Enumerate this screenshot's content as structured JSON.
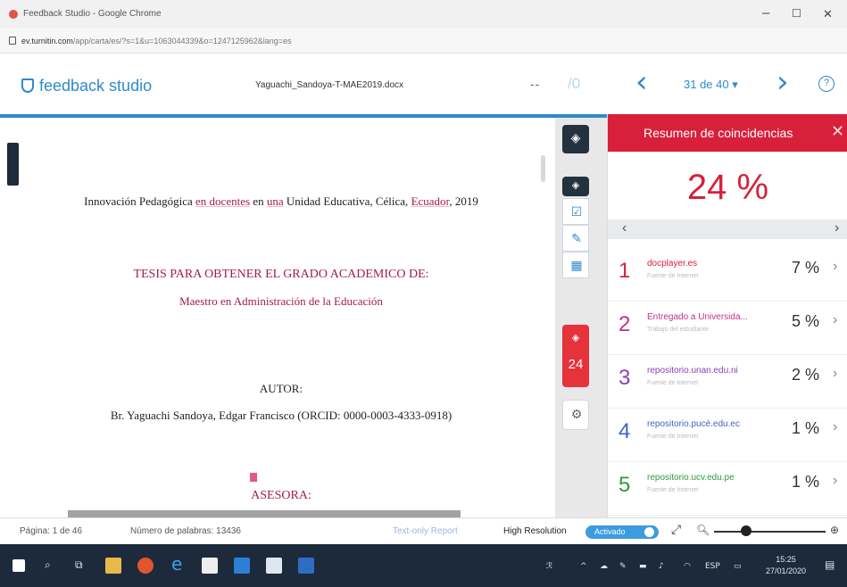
{
  "browser": {
    "window_title": "Feedback Studio - Google Chrome",
    "url_host": "ev.turnitin.com",
    "url_path": "/app/carta/es/?s=1&u=1063044339&o=1247125962&lang=es",
    "controls": {
      "minimize": "–",
      "maximize": "☐",
      "close": "✕"
    }
  },
  "header": {
    "brand": "feedback studio",
    "filename": "Yaguachi_Sandoya-T-MAE2019.docx",
    "dash": "--",
    "slash_zero": "/0",
    "pager": "31 de 40 ▾",
    "prev_icon": "‹",
    "next_icon": "›",
    "help_icon": "?"
  },
  "document": {
    "title_pre": "Innovación Pedagógica ",
    "title_hl1": "en docentes",
    "title_mid": " en ",
    "title_hl2": "una",
    "title_mid2": " Unidad Educativa, Célica, ",
    "title_hl3": "Ecuador",
    "title_post": ", 2019",
    "tesis": "TESIS PARA OBTENER EL GRADO ACADEMICO DE:",
    "degree": "Maestro en Administración de la Educación",
    "autor_label": "AUTOR:",
    "autor": "Br. Yaguachi Sandoya, Edgar Francisco (ORCID: 0000-0003-4333-0918)",
    "asesora_label": "ASESORA:"
  },
  "rail": {
    "count": "24",
    "icons": [
      "layers-icon",
      "layers-small-icon",
      "check-icon",
      "edit-icon",
      "grid-icon",
      "similarity-icon",
      "gear-icon"
    ]
  },
  "panel": {
    "title": "Resumen de coincidencias",
    "close": "✕",
    "total": "24 %",
    "nav_left": "‹",
    "nav_right": "›",
    "matches": [
      {
        "n": "1",
        "source": "docplayer.es",
        "sub": "Fuente de Internet",
        "pct": "7 %",
        "color": "#d8203a"
      },
      {
        "n": "2",
        "source": "Entregado a Universida...",
        "sub": "Trabajo del estudiante",
        "pct": "5 %",
        "color": "#c0328a"
      },
      {
        "n": "3",
        "source": "repositorio.unan.edu.ni",
        "sub": "Fuente de Internet",
        "pct": "2 %",
        "color": "#8e3dba"
      },
      {
        "n": "4",
        "source": "repositorio.pucé.edu.ec",
        "sub": "Fuente de Internet",
        "pct": "1 %",
        "color": "#3f64c8"
      },
      {
        "n": "5",
        "source": "repositorio.ucv.edu.pe",
        "sub": "Fuente de Internet",
        "pct": "1 %",
        "color": "#2f9a3e"
      }
    ]
  },
  "status": {
    "page": "Página: 1 de 46",
    "words": "Número de palabras: 13436",
    "textonly": "Text-only Report",
    "hires": "High Resolution",
    "toggle": "Activado"
  },
  "taskbar": {
    "time": "15:25",
    "date": "27/01/2020",
    "lang": "ESP"
  }
}
